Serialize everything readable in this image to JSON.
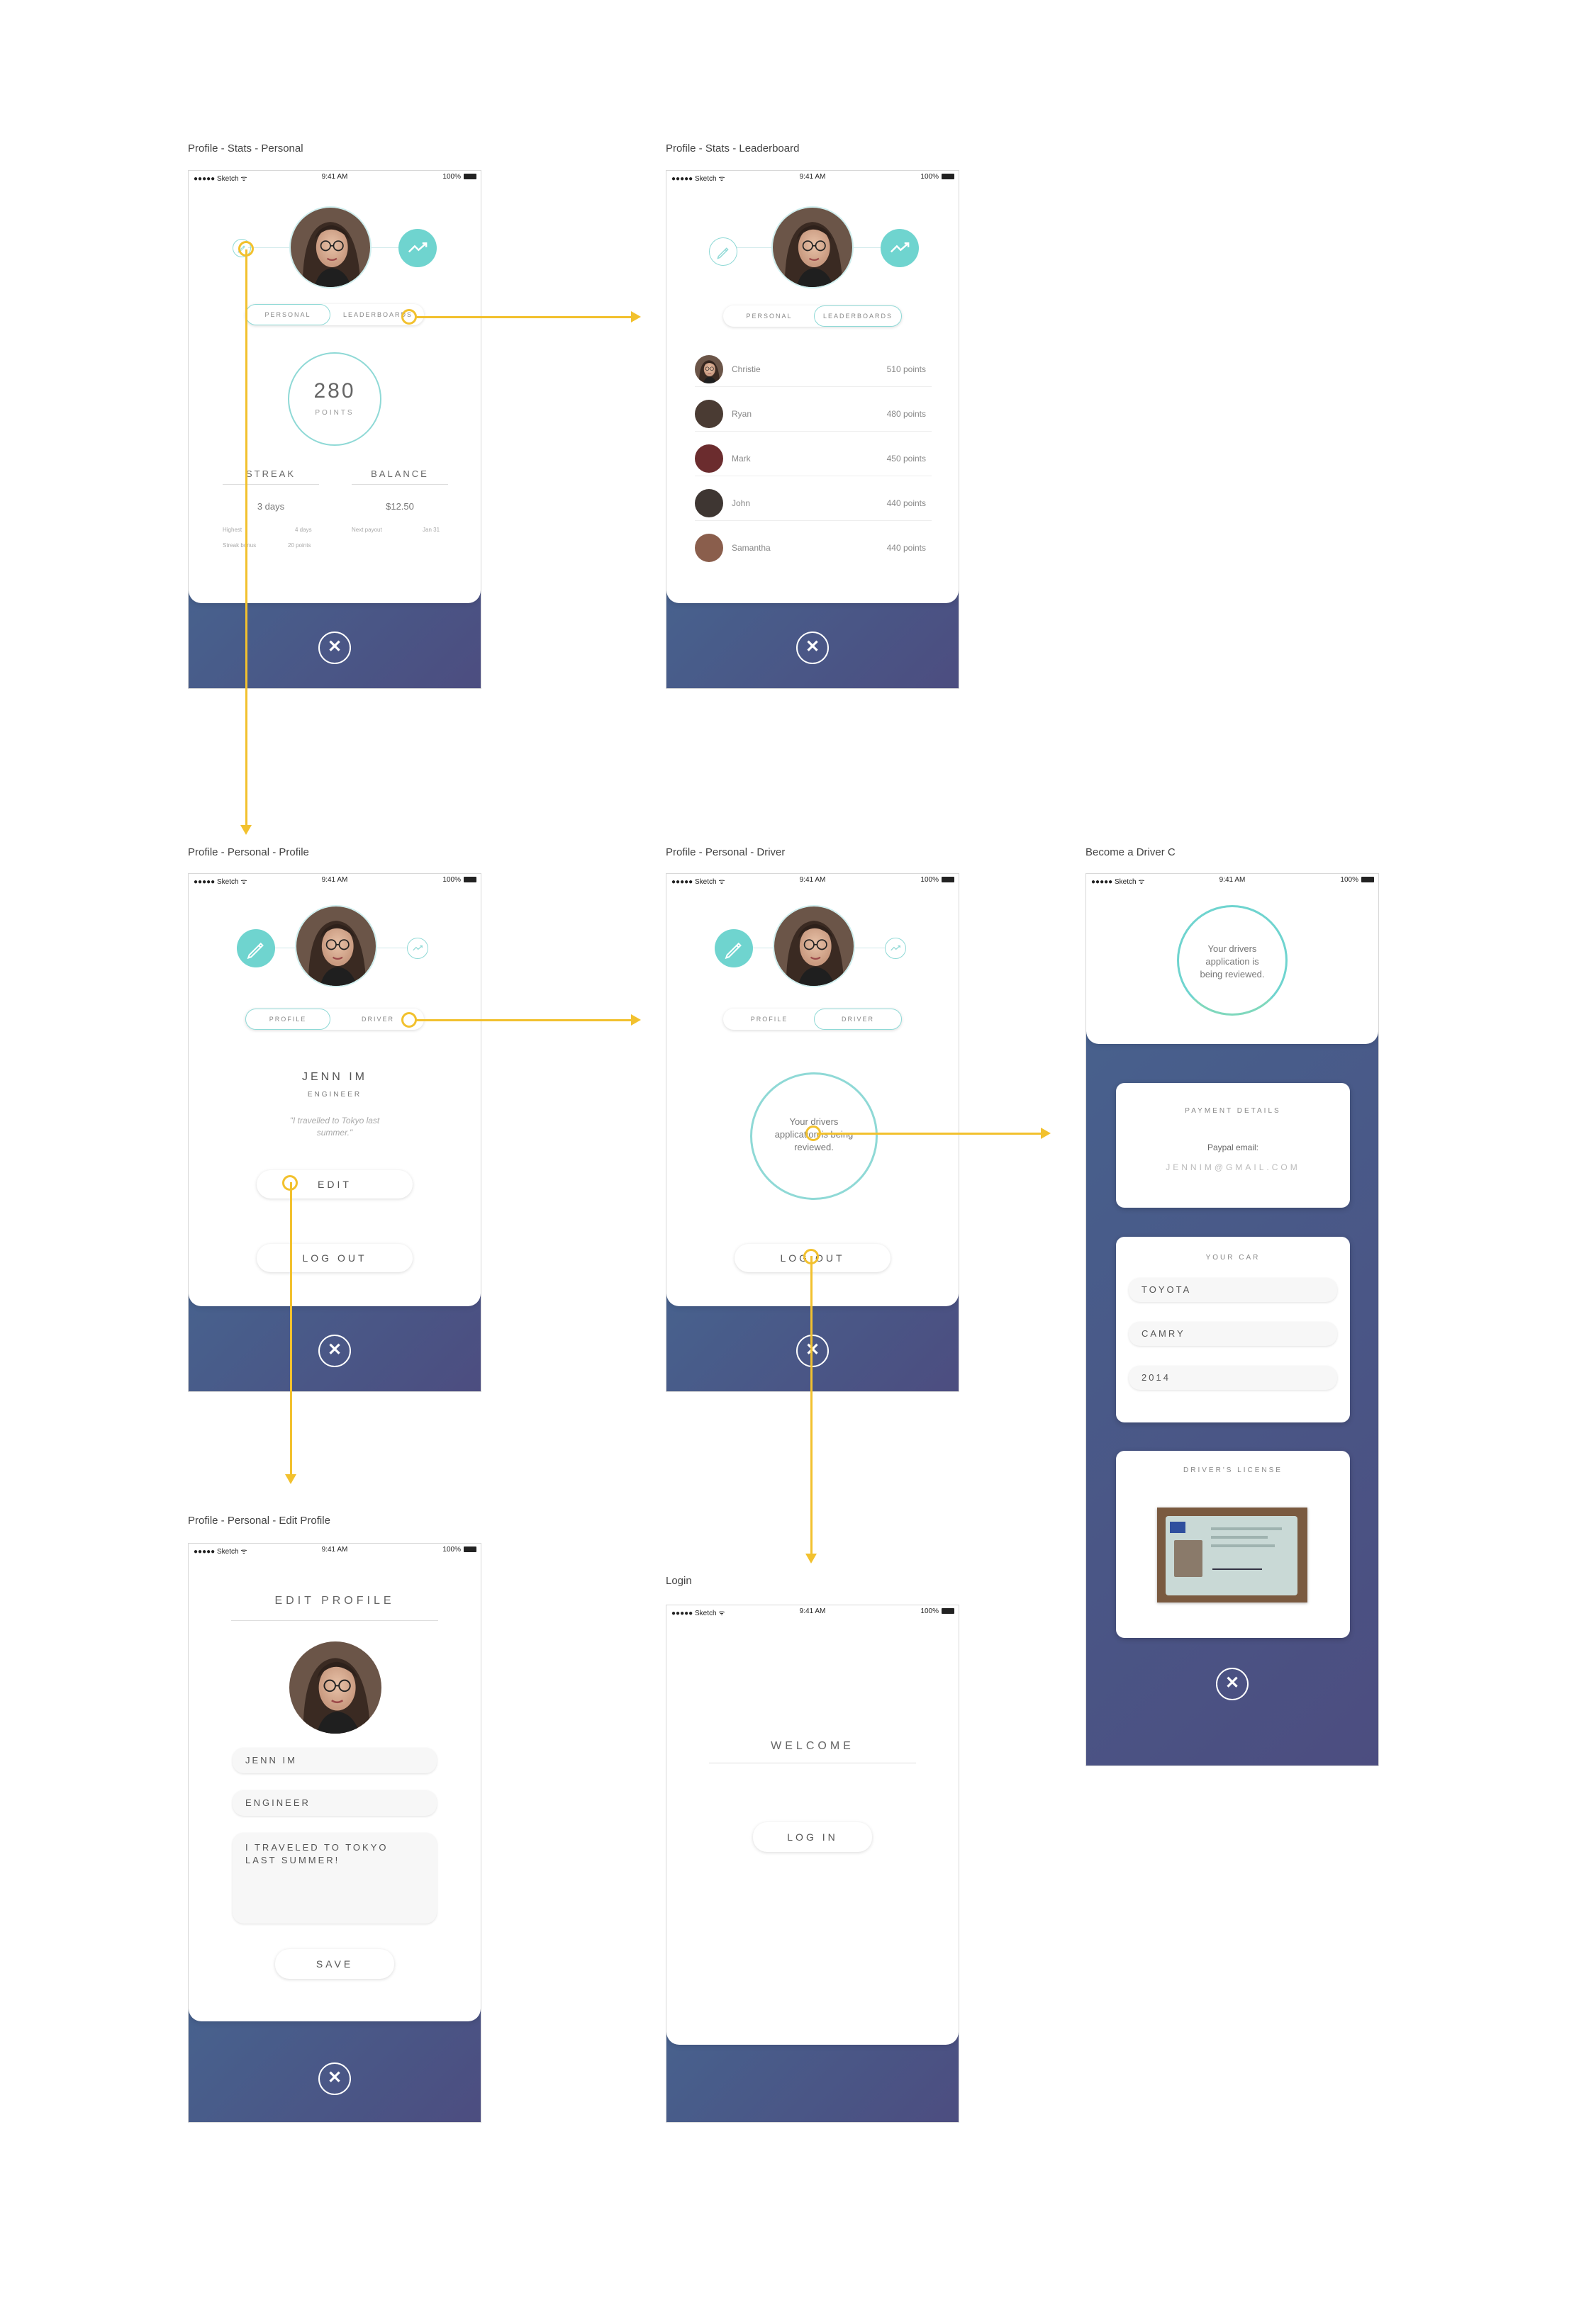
{
  "statusbar": {
    "carrier": "●●●●● Sketch ᯤ",
    "time": "9:41 AM",
    "battery": "100%"
  },
  "close_glyph": "✕",
  "labels": {
    "stats_personal": "Profile - Stats - Personal",
    "stats_leaderboard": "Profile - Stats - Leaderboard",
    "personal_profile": "Profile - Personal - Profile",
    "personal_driver": "Profile - Personal - Driver",
    "become_driver": "Become a Driver C",
    "edit_profile": "Profile - Personal - Edit Profile",
    "login": "Login"
  },
  "stats_personal": {
    "tabs": [
      "PERSONAL",
      "LEADERBOARDS"
    ],
    "points_value": "280",
    "points_label": "POINTS",
    "streak_title": "STREAK",
    "streak_value": "3 days",
    "streak_highest_label": "Highest",
    "streak_highest_value": "4 days",
    "streak_bonus_label": "Streak bonus",
    "streak_bonus_value": "20 points",
    "balance_title": "BALANCE",
    "balance_value": "$12.50",
    "next_payout_label": "Next payout",
    "next_payout_value": "Jan 31"
  },
  "leaderboard": {
    "tabs": [
      "PERSONAL",
      "LEADERBOARDS"
    ],
    "rows": [
      {
        "name": "Christie",
        "points": "510 points"
      },
      {
        "name": "Ryan",
        "points": "480 points"
      },
      {
        "name": "Mark",
        "points": "450 points"
      },
      {
        "name": "John",
        "points": "440 points"
      },
      {
        "name": "Samantha",
        "points": "440 points"
      }
    ]
  },
  "profile": {
    "tabs": [
      "PROFILE",
      "DRIVER"
    ],
    "name": "JENN IM",
    "occupation": "ENGINEER",
    "quote": "\"I travelled to Tokyo last summer.\"",
    "edit_label": "EDIT",
    "logout_label": "LOG OUT"
  },
  "driver": {
    "tabs": [
      "PROFILE",
      "DRIVER"
    ],
    "status": "Your drivers application is being reviewed.",
    "logout_label": "LOG OUT"
  },
  "become_driver": {
    "status": "Your drivers application is being reviewed.",
    "payment_title": "PAYMENT DETAILS",
    "paypal_label": "Paypal email:",
    "paypal_email": "JENNIM@GMAIL.COM",
    "car_title": "YOUR CAR",
    "car_make": "TOYOTA",
    "car_model": "CAMRY",
    "car_year": "2014",
    "license_title": "DRIVER'S LICENSE"
  },
  "edit_profile": {
    "title": "EDIT PROFILE",
    "name_value": "JENN IM",
    "occupation_value": "ENGINEER",
    "bio_value": "I TRAVELED TO TOKYO LAST SUMMER!",
    "save_label": "SAVE"
  },
  "login": {
    "welcome": "WELCOME",
    "login_label": "LOG IN"
  },
  "colors": {
    "accent_teal": "#6fd4cf",
    "flow_yellow": "#f2c12e",
    "gradient_start": "#47628e",
    "gradient_end": "#4c4d80"
  }
}
